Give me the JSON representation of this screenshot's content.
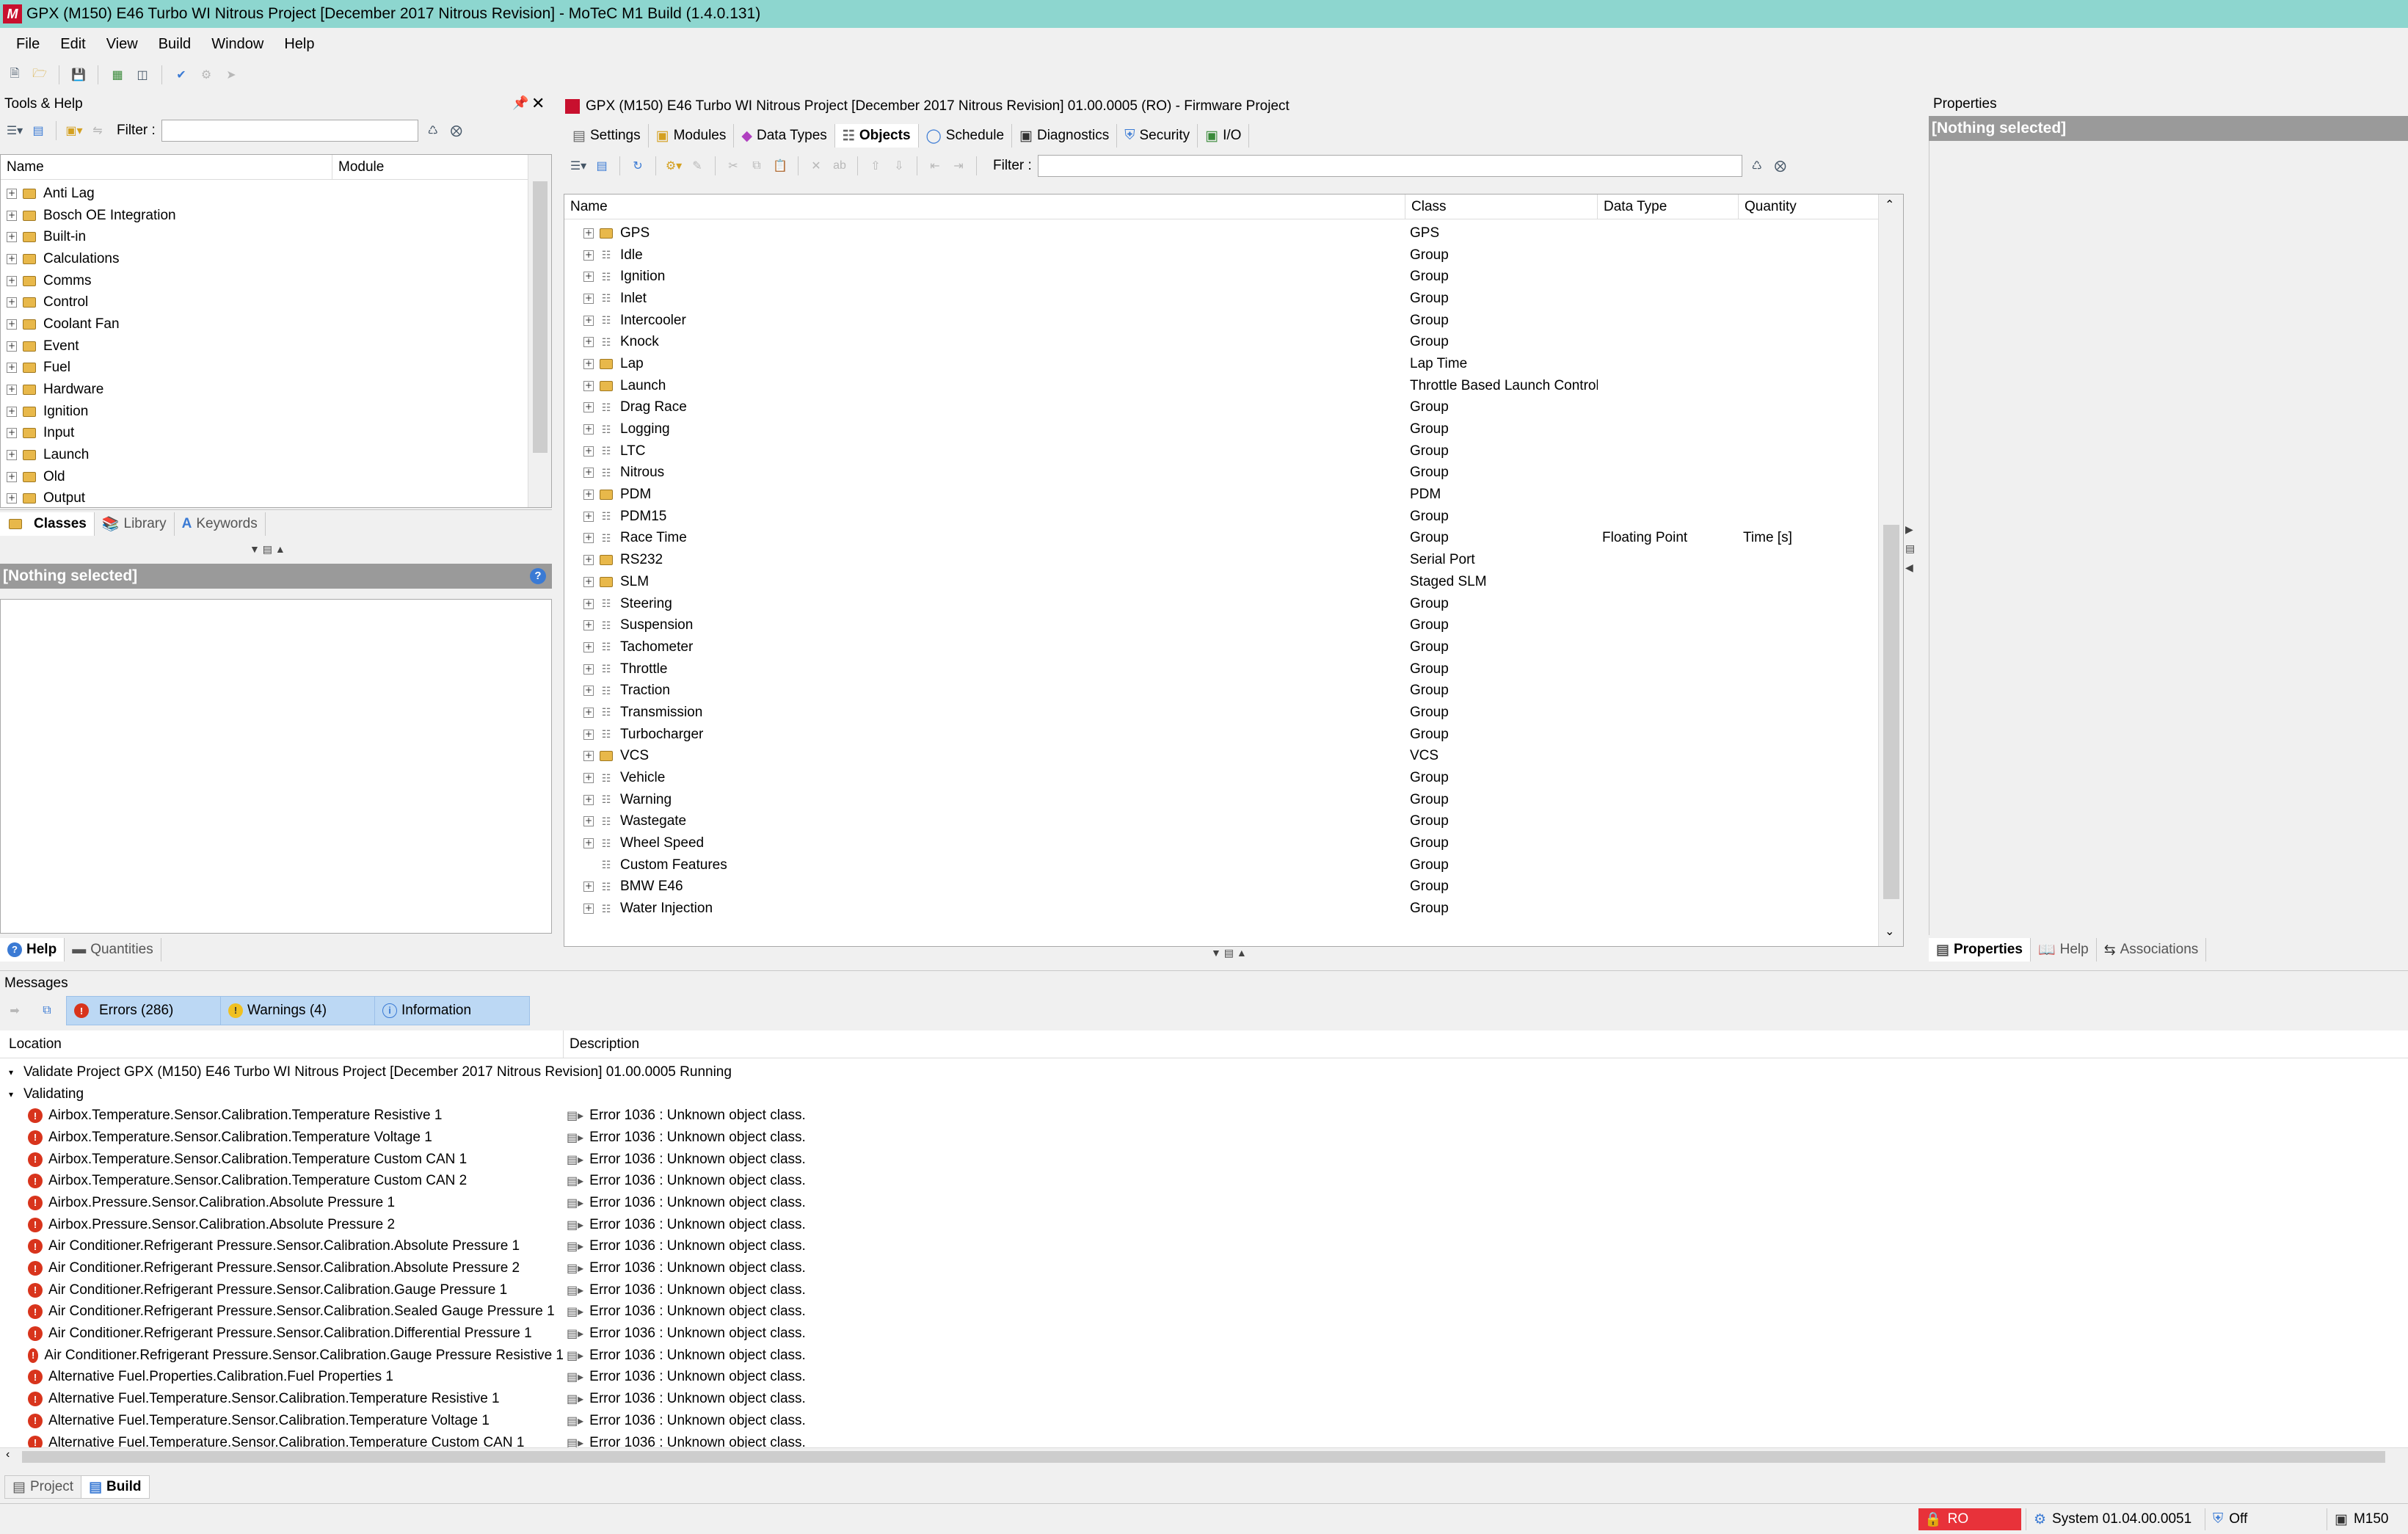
{
  "window": {
    "title": "GPX (M150) E46 Turbo WI Nitrous Project [December 2017 Nitrous Revision] - MoTeC M1 Build (1.4.0.131)"
  },
  "menu": [
    "File",
    "Edit",
    "View",
    "Build",
    "Window",
    "Help"
  ],
  "tools_panel": {
    "title": "Tools & Help",
    "filter_label": "Filter :",
    "columns": [
      "Name",
      "Module"
    ],
    "items": [
      "Anti Lag",
      "Bosch OE Integration",
      "Built-in",
      "Calculations",
      "Comms",
      "Control",
      "Coolant Fan",
      "Event",
      "Fuel",
      "Hardware",
      "Ignition",
      "Input",
      "Launch",
      "Old",
      "Output"
    ],
    "tabs": [
      "Classes",
      "Library",
      "Keywords"
    ],
    "nothing_selected": "[Nothing selected]",
    "bottom_tabs": [
      "Help",
      "Quantities"
    ]
  },
  "project_panel": {
    "title": "GPX (M150) E46 Turbo WI Nitrous Project [December 2017 Nitrous Revision] 01.00.0005 (RO) - Firmware Project",
    "tabs": [
      "Settings",
      "Modules",
      "Data Types",
      "Objects",
      "Schedule",
      "Diagnostics",
      "Security",
      "I/O"
    ],
    "active_tab": "Objects",
    "filter_label": "Filter :",
    "columns": [
      "Name",
      "Class",
      "Data Type",
      "Quantity"
    ],
    "rows": [
      {
        "name": "GPS",
        "class": "GPS",
        "data_type": "",
        "quantity": "",
        "icon": "class"
      },
      {
        "name": "Idle",
        "class": "Group",
        "data_type": "",
        "quantity": "",
        "icon": "group"
      },
      {
        "name": "Ignition",
        "class": "Group",
        "data_type": "",
        "quantity": "",
        "icon": "group"
      },
      {
        "name": "Inlet",
        "class": "Group",
        "data_type": "",
        "quantity": "",
        "icon": "group"
      },
      {
        "name": "Intercooler",
        "class": "Group",
        "data_type": "",
        "quantity": "",
        "icon": "group"
      },
      {
        "name": "Knock",
        "class": "Group",
        "data_type": "",
        "quantity": "",
        "icon": "group"
      },
      {
        "name": "Lap",
        "class": "Lap Time",
        "data_type": "",
        "quantity": "",
        "icon": "class"
      },
      {
        "name": "Launch",
        "class": "Throttle Based Launch Control",
        "data_type": "",
        "quantity": "",
        "icon": "class"
      },
      {
        "name": "Drag Race",
        "class": "Group",
        "data_type": "",
        "quantity": "",
        "icon": "group"
      },
      {
        "name": "Logging",
        "class": "Group",
        "data_type": "",
        "quantity": "",
        "icon": "group"
      },
      {
        "name": "LTC",
        "class": "Group",
        "data_type": "",
        "quantity": "",
        "icon": "group"
      },
      {
        "name": "Nitrous",
        "class": "Group",
        "data_type": "",
        "quantity": "",
        "icon": "group"
      },
      {
        "name": "PDM",
        "class": "PDM",
        "data_type": "",
        "quantity": "",
        "icon": "class"
      },
      {
        "name": "PDM15",
        "class": "Group",
        "data_type": "",
        "quantity": "",
        "icon": "group"
      },
      {
        "name": "Race Time",
        "class": "Group",
        "data_type": "Floating Point",
        "quantity": "Time [s]",
        "icon": "group"
      },
      {
        "name": "RS232",
        "class": "Serial Port",
        "data_type": "",
        "quantity": "",
        "icon": "class"
      },
      {
        "name": "SLM",
        "class": "Staged SLM",
        "data_type": "",
        "quantity": "",
        "icon": "class"
      },
      {
        "name": "Steering",
        "class": "Group",
        "data_type": "",
        "quantity": "",
        "icon": "group"
      },
      {
        "name": "Suspension",
        "class": "Group",
        "data_type": "",
        "quantity": "",
        "icon": "group"
      },
      {
        "name": "Tachometer",
        "class": "Group",
        "data_type": "",
        "quantity": "",
        "icon": "group"
      },
      {
        "name": "Throttle",
        "class": "Group",
        "data_type": "",
        "quantity": "",
        "icon": "group"
      },
      {
        "name": "Traction",
        "class": "Group",
        "data_type": "",
        "quantity": "",
        "icon": "group"
      },
      {
        "name": "Transmission",
        "class": "Group",
        "data_type": "",
        "quantity": "",
        "icon": "group"
      },
      {
        "name": "Turbocharger",
        "class": "Group",
        "data_type": "",
        "quantity": "",
        "icon": "group"
      },
      {
        "name": "VCS",
        "class": "VCS",
        "data_type": "",
        "quantity": "",
        "icon": "class"
      },
      {
        "name": "Vehicle",
        "class": "Group",
        "data_type": "",
        "quantity": "",
        "icon": "group"
      },
      {
        "name": "Warning",
        "class": "Group",
        "data_type": "",
        "quantity": "",
        "icon": "group"
      },
      {
        "name": "Wastegate",
        "class": "Group",
        "data_type": "",
        "quantity": "",
        "icon": "group"
      },
      {
        "name": "Wheel Speed",
        "class": "Group",
        "data_type": "",
        "quantity": "",
        "icon": "group"
      },
      {
        "name": "Custom Features",
        "class": "Group",
        "data_type": "",
        "quantity": "",
        "icon": "group",
        "no_expander": true
      },
      {
        "name": "BMW E46",
        "class": "Group",
        "data_type": "",
        "quantity": "",
        "icon": "group"
      },
      {
        "name": "Water Injection",
        "class": "Group",
        "data_type": "",
        "quantity": "",
        "icon": "group"
      }
    ]
  },
  "properties_panel": {
    "title": "Properties",
    "nothing_selected": "[Nothing selected]",
    "bottom_tabs": [
      "Properties",
      "Help",
      "Associations"
    ]
  },
  "messages_panel": {
    "title": "Messages",
    "filter_tabs": [
      "Errors (286)",
      "Warnings (4)",
      "Information"
    ],
    "columns": [
      "Location",
      "Description"
    ],
    "headers": [
      "Validate Project GPX (M150) E46 Turbo WI Nitrous Project [December 2017 Nitrous Revision] 01.00.0005 Running",
      "Validating"
    ],
    "rows": [
      {
        "location": "Airbox.Temperature.Sensor.Calibration.Temperature Resistive 1",
        "description": "Error 1036 : Unknown object class."
      },
      {
        "location": "Airbox.Temperature.Sensor.Calibration.Temperature Voltage 1",
        "description": "Error 1036 : Unknown object class."
      },
      {
        "location": "Airbox.Temperature.Sensor.Calibration.Temperature Custom CAN 1",
        "description": "Error 1036 : Unknown object class."
      },
      {
        "location": "Airbox.Temperature.Sensor.Calibration.Temperature Custom CAN 2",
        "description": "Error 1036 : Unknown object class."
      },
      {
        "location": "Airbox.Pressure.Sensor.Calibration.Absolute Pressure 1",
        "description": "Error 1036 : Unknown object class."
      },
      {
        "location": "Airbox.Pressure.Sensor.Calibration.Absolute Pressure 2",
        "description": "Error 1036 : Unknown object class."
      },
      {
        "location": "Air Conditioner.Refrigerant Pressure.Sensor.Calibration.Absolute Pressure 1",
        "description": "Error 1036 : Unknown object class."
      },
      {
        "location": "Air Conditioner.Refrigerant Pressure.Sensor.Calibration.Absolute Pressure 2",
        "description": "Error 1036 : Unknown object class."
      },
      {
        "location": "Air Conditioner.Refrigerant Pressure.Sensor.Calibration.Gauge Pressure 1",
        "description": "Error 1036 : Unknown object class."
      },
      {
        "location": "Air Conditioner.Refrigerant Pressure.Sensor.Calibration.Sealed Gauge Pressure 1",
        "description": "Error 1036 : Unknown object class."
      },
      {
        "location": "Air Conditioner.Refrigerant Pressure.Sensor.Calibration.Differential Pressure 1",
        "description": "Error 1036 : Unknown object class."
      },
      {
        "location": "Air Conditioner.Refrigerant Pressure.Sensor.Calibration.Gauge Pressure Resistive 1",
        "description": "Error 1036 : Unknown object class."
      },
      {
        "location": "Alternative Fuel.Properties.Calibration.Fuel Properties 1",
        "description": "Error 1036 : Unknown object class."
      },
      {
        "location": "Alternative Fuel.Temperature.Sensor.Calibration.Temperature Resistive 1",
        "description": "Error 1036 : Unknown object class."
      },
      {
        "location": "Alternative Fuel.Temperature.Sensor.Calibration.Temperature Voltage 1",
        "description": "Error 1036 : Unknown object class."
      },
      {
        "location": "Alternative Fuel.Temperature.Sensor.Calibration.Temperature Custom CAN 1",
        "description": "Error 1036 : Unknown object class."
      }
    ]
  },
  "bottom_tabs": [
    "Project",
    "Build"
  ],
  "active_bottom_tab": "Build",
  "status": {
    "ro": "RO",
    "system": "System 01.04.00.0051",
    "security": "Off",
    "device": "M150"
  }
}
